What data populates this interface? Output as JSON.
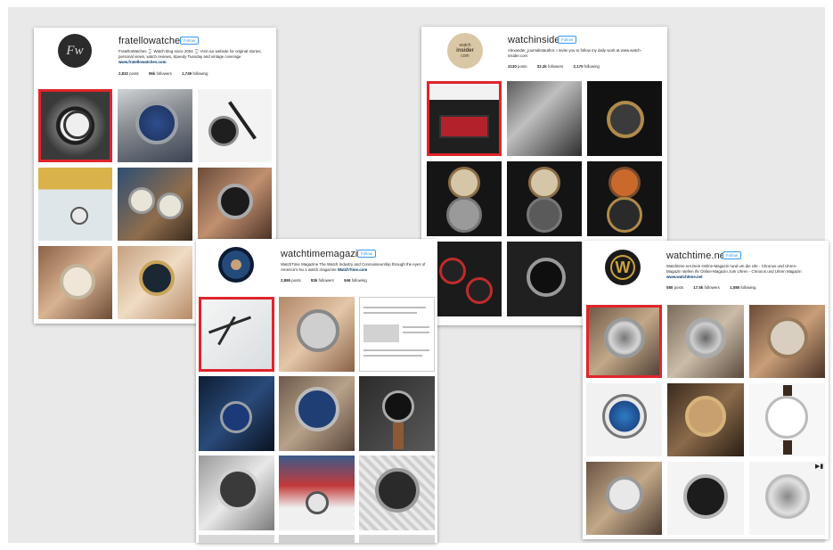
{
  "accounts": [
    {
      "id": "fratello",
      "username": "fratellowatches",
      "follow_label": "Follow",
      "avatar_text": "Fw",
      "bio_line1": "FratelloWatches ⌚ Watch blog since 2004 ⌚ Visit our website for original stories,",
      "bio_line2": "personal views, watch reviews, Speedy Tuesday and vintage coverage",
      "link": "www.fratellowatches.com",
      "stats": {
        "posts": "2,832",
        "posts_label": "posts",
        "followers": "96k",
        "followers_label": "followers",
        "following": "1,749",
        "following_label": "following"
      }
    },
    {
      "id": "watchinsider",
      "username": "watchinsider",
      "follow_label": "Follow",
      "avatar_text_1": "watch",
      "avatar_text_2": "insider",
      "avatar_text_3": "com",
      "bio_line1": "Alexander_journalistauthor. I invite you to follow my daily work at www.watch-",
      "bio_line2": "insider.com",
      "link": "",
      "stats": {
        "posts": "3130",
        "posts_label": "posts",
        "followers": "32.2k",
        "followers_label": "followers",
        "following": "2,170",
        "following_label": "following"
      }
    },
    {
      "id": "watchtimemagazine",
      "username": "watchtimemagazine",
      "follow_label": "Follow",
      "bio_line1": "WatchTime Magazine The Watch Industry and Connoisseurship through the eyes of",
      "bio_line2": "America's No.1 watch magazine",
      "link": "WatchTime.com",
      "stats": {
        "posts": "2,895",
        "posts_label": "posts",
        "followers": "83k",
        "followers_label": "followers",
        "following": "946",
        "following_label": "following"
      }
    },
    {
      "id": "watchtimenet",
      "username": "watchtime.net",
      "follow_label": "Follow",
      "avatar_text": "W",
      "bio_line1": "Watchtime.net Dein Online-Magazin rund um die Uhr - Chronos und Uhren-",
      "bio_line2": "Magazin stellen Ihr Online-Magazin zum Uhren - Chronos und Uhren Magazin",
      "link": "www.watchtime.net",
      "stats": {
        "posts": "580",
        "posts_label": "posts",
        "followers": "17.5k",
        "followers_label": "followers",
        "following": "1,086",
        "following_label": "following"
      }
    }
  ],
  "colors": {
    "selection": "#e0242b",
    "follow": "#3897f0",
    "background": "#e9e9e9"
  },
  "icons": {
    "video": "video-camera-icon"
  }
}
